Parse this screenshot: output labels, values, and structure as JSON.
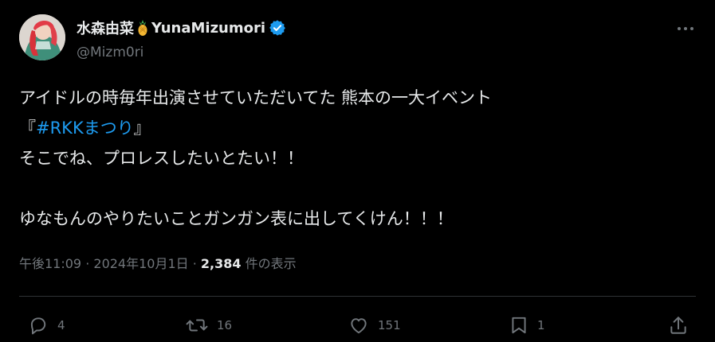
{
  "author": {
    "display_name": "水森由菜",
    "display_name_latin": "YunaMizumori",
    "handle": "@Mizm0ri"
  },
  "post": {
    "lines": [
      "アイドルの時毎年出演させていただいてた 熊本の一大イベント",
      "",
      "そこでね、プロレスしたいとたい！！",
      "",
      "ゆなもんのやりたいことガンガン表に出してくけん！！！"
    ],
    "hashtag_line": {
      "open": "『",
      "hashtag": "#RKKまつり",
      "close": "』"
    }
  },
  "meta": {
    "time": "午後11:09",
    "separator": " · ",
    "date": "2024年10月1日",
    "views": "2,384",
    "views_label": " 件の表示"
  },
  "actions": {
    "replies": "4",
    "reposts": "16",
    "likes": "151",
    "bookmarks": "1"
  },
  "colors": {
    "background": "#000000",
    "text": "#e7e9ea",
    "muted": "#71767b",
    "accent": "#1d9bf0",
    "divider": "#2f3336"
  },
  "icons": [
    "pineapple-icon",
    "verified-icon",
    "more-icon",
    "reply-icon",
    "repost-icon",
    "like-icon",
    "bookmark-icon",
    "share-icon"
  ]
}
